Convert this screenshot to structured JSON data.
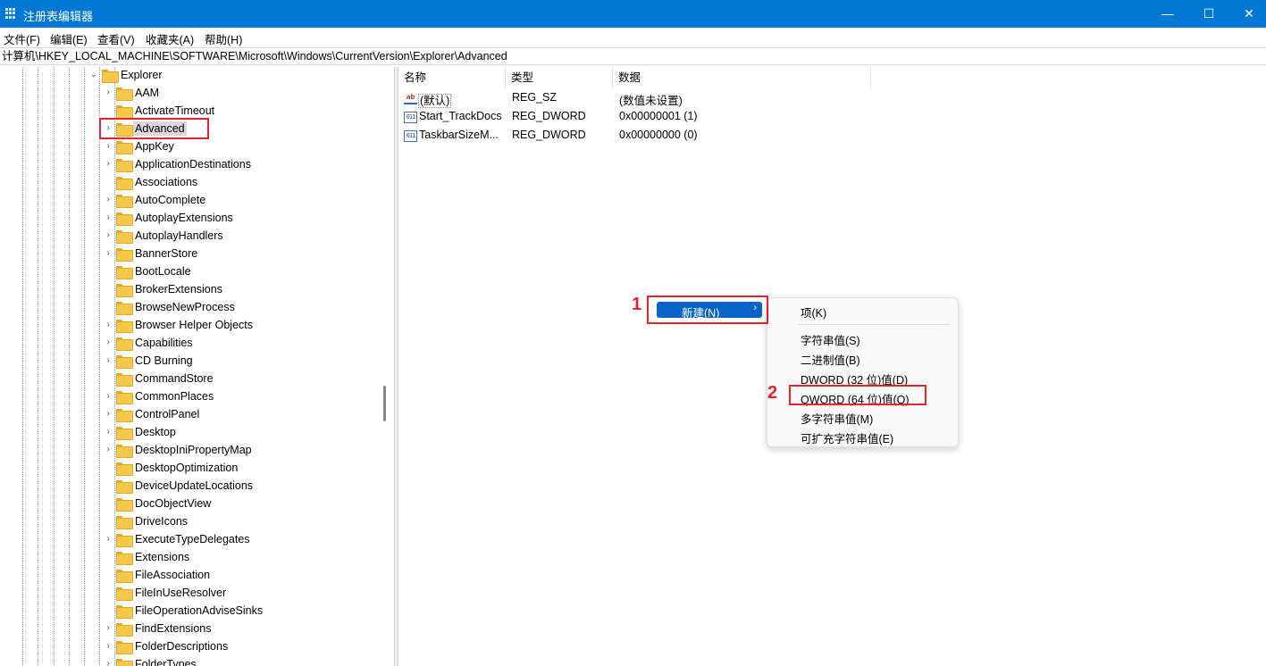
{
  "window": {
    "title": "注册表编辑器",
    "minimize_glyph": "—",
    "maximize_glyph": "☐",
    "close_glyph": "✕"
  },
  "menu": [
    "文件(F)",
    "编辑(E)",
    "查看(V)",
    "收藏夹(A)",
    "帮助(H)"
  ],
  "address": "计算机\\HKEY_LOCAL_MACHINE\\SOFTWARE\\Microsoft\\Windows\\CurrentVersion\\Explorer\\Advanced",
  "tree": {
    "parent": "Explorer",
    "children": [
      "AAM",
      "ActivateTimeout",
      "Advanced",
      "AppKey",
      "ApplicationDestinations",
      "Associations",
      "AutoComplete",
      "AutoplayExtensions",
      "AutoplayHandlers",
      "BannerStore",
      "BootLocale",
      "BrokerExtensions",
      "BrowseNewProcess",
      "Browser Helper Objects",
      "Capabilities",
      "CD Burning",
      "CommandStore",
      "CommonPlaces",
      "ControlPanel",
      "Desktop",
      "DesktopIniPropertyMap",
      "DesktopOptimization",
      "DeviceUpdateLocations",
      "DocObjectView",
      "DriveIcons",
      "ExecuteTypeDelegates",
      "Extensions",
      "FileAssociation",
      "FileInUseResolver",
      "FileOperationAdviseSinks",
      "FindExtensions",
      "FolderDescriptions",
      "FolderTypes"
    ],
    "selected": "Advanced"
  },
  "list": {
    "columns": [
      "名称",
      "类型",
      "数据"
    ],
    "rows": [
      {
        "icon": "string-value-icon",
        "icon_text": "ab",
        "name": "(默认)",
        "type": "REG_SZ",
        "data": "(数值未设置)"
      },
      {
        "icon": "binary-value-icon",
        "icon_text": "011",
        "name": "Start_TrackDocs",
        "type": "REG_DWORD",
        "data": "0x00000001 (1)"
      },
      {
        "icon": "binary-value-icon",
        "icon_text": "011",
        "name": "TaskbarSizeM...",
        "type": "REG_DWORD",
        "data": "0x00000000 (0)"
      }
    ]
  },
  "context_menu": {
    "new_label": "新建(N)",
    "arrow": "›"
  },
  "submenu": {
    "key": "项(K)",
    "items": [
      "字符串值(S)",
      "二进制值(B)",
      "DWORD (32 位)值(D)",
      "QWORD (64 位)值(Q)",
      "多字符串值(M)",
      "可扩充字符串值(E)"
    ]
  },
  "annotations": {
    "step1": "1",
    "step2": "2",
    "color": "#e5232f"
  },
  "colors": {
    "titlebar": "#0078d4",
    "menu_highlight": "#0a64c8",
    "folder": "#f8c84a"
  }
}
